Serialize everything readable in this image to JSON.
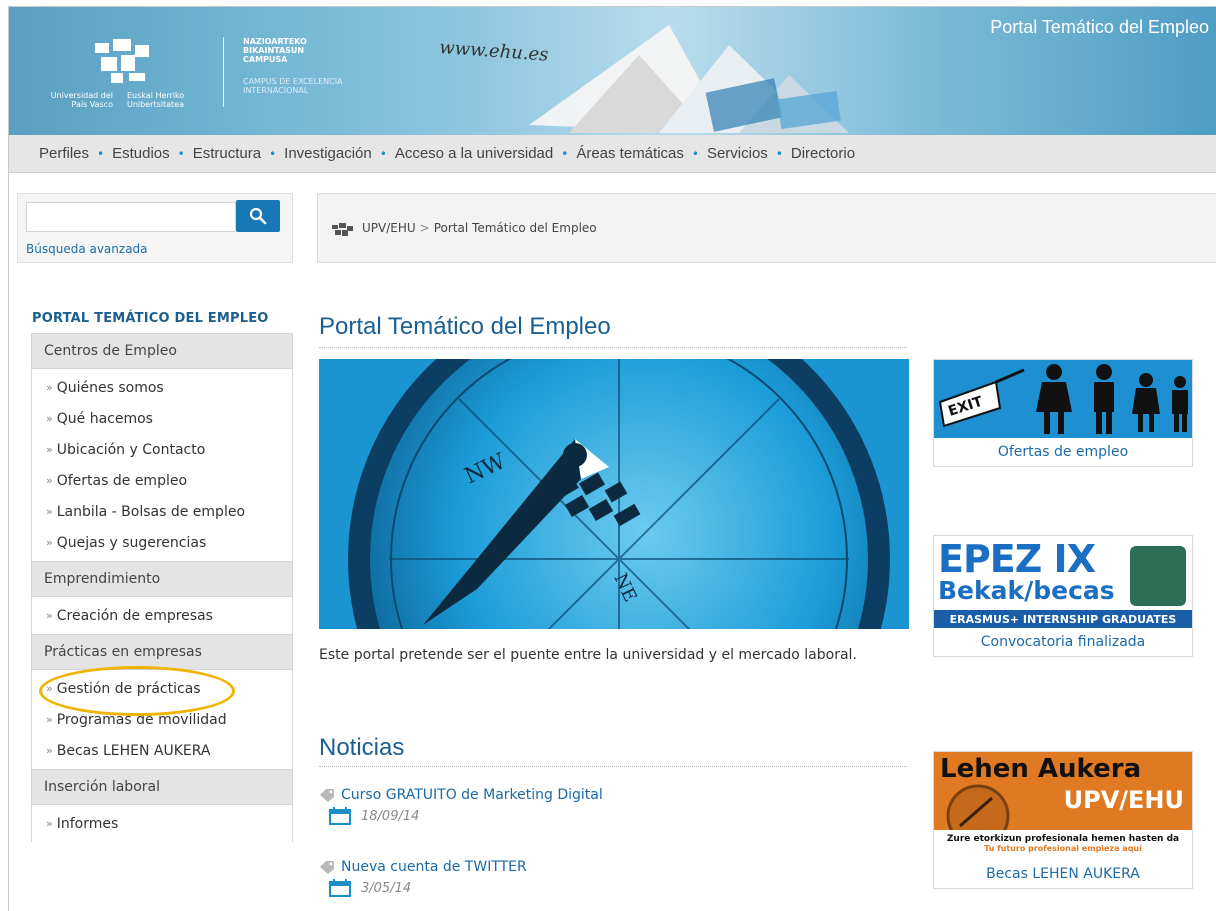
{
  "header": {
    "uni_name_es": "Universidad del País Vasco",
    "uni_name_eu": "Euskal Herriko Unibertsitatea",
    "campus_eu": "NAZIOARTEKO BIKAINTASUN CAMPUSA",
    "campus_es": "CAMPUS DE EXCELENCIA INTERNACIONAL",
    "url": "www.ehu.es",
    "portal_title": "Portal Temático del Empleo"
  },
  "nav": {
    "items": [
      "Perfiles",
      "Estudios",
      "Estructura",
      "Investigación",
      "Acceso a la universidad",
      "Áreas temáticas",
      "Servicios",
      "Directorio"
    ]
  },
  "search": {
    "value": "",
    "placeholder": "",
    "advanced_label": "Búsqueda avanzada"
  },
  "breadcrumb": {
    "root": "UPV/EHU",
    "separator": ">",
    "current": "Portal Temático del Empleo"
  },
  "sidebar": {
    "title": "PORTAL TEMÁTICO DEL EMPLEO",
    "groups": [
      {
        "label": "Centros de Empleo",
        "items": [
          "Quiénes somos",
          "Qué hacemos",
          "Ubicación y Contacto",
          "Ofertas de empleo",
          "Lanbila - Bolsas de empleo",
          "Quejas y sugerencias"
        ]
      },
      {
        "label": "Emprendimiento",
        "items": [
          "Creación de empresas"
        ]
      },
      {
        "label": "Prácticas en empresas",
        "items": [
          "Gestión de prácticas",
          "Programas de movilidad",
          "Becas LEHEN AUKERA"
        ]
      },
      {
        "label": "Inserción laboral",
        "items": [
          "Informes"
        ]
      }
    ]
  },
  "main": {
    "title": "Portal Temático del Empleo",
    "caption": "Este portal pretende ser el puente entre la universidad y el mercado laboral.",
    "news_title": "Noticias",
    "news": [
      {
        "title": "Curso GRATUITO de Marketing Digital",
        "date": "18/09/14"
      },
      {
        "title": "Nueva cuenta de TWITTER",
        "date": "3/05/14"
      }
    ]
  },
  "promos": {
    "ofertas": {
      "label": "Ofertas de empleo",
      "exit_text": "EXIT"
    },
    "epez": {
      "label": "Convocatoria finalizada",
      "line1": "EPEZ IX",
      "line2": "Bekak/becas",
      "line3": "ERASMUS+ INTERNSHIP GRADUATES"
    },
    "lehen": {
      "label": "Becas LEHEN AUKERA",
      "line1": "Lehen Aukera",
      "line2": "UPV/EHU",
      "line3": "Zure etorkizun profesionala hemen hasten da",
      "line4": "Tu futuro profesional empieza aquí"
    }
  },
  "colors": {
    "accent": "#1a5f91",
    "link": "#1a6aa6",
    "nav_dot": "#1b8fc6",
    "highlight": "#f0b400"
  }
}
